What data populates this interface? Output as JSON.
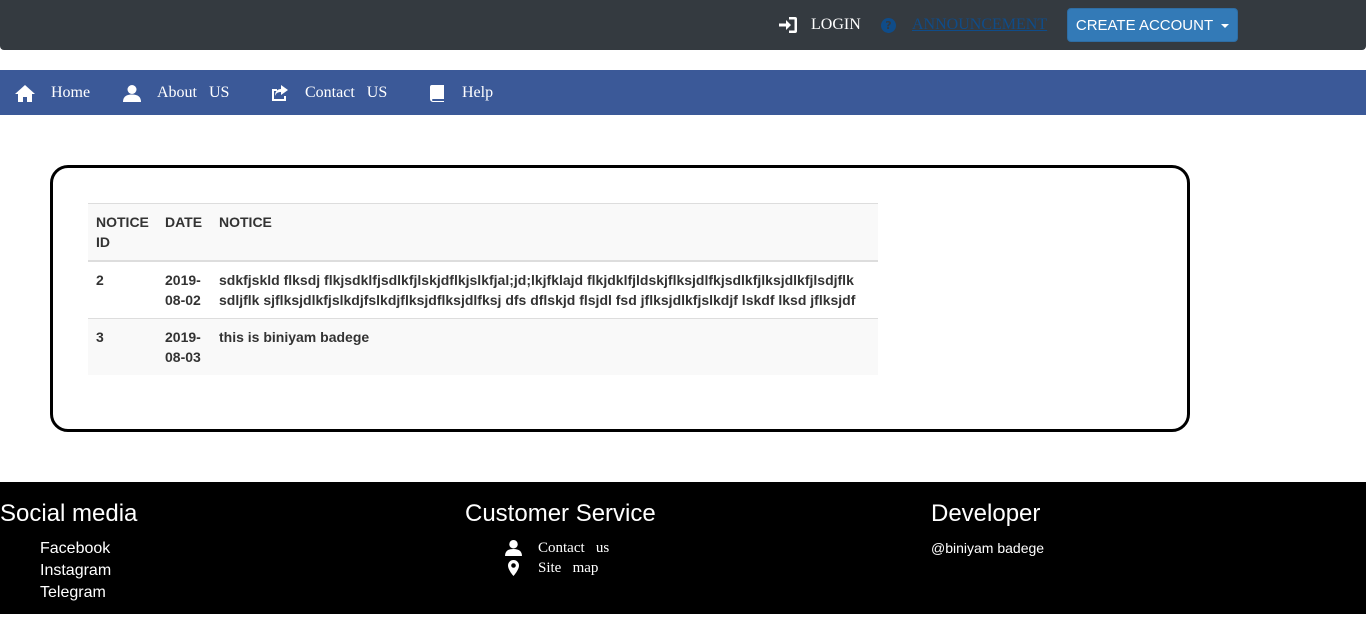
{
  "topbar": {
    "login_label": "LOGIN",
    "announcement_label": "ANNOUNCEMENT",
    "create_account_label": "CREATE ACCOUNT"
  },
  "nav": {
    "items": [
      {
        "label": "Home",
        "icon": "home-icon"
      },
      {
        "label": "About   US",
        "icon": "user-icon"
      },
      {
        "label": "Contact   US",
        "icon": "share-icon"
      },
      {
        "label": "Help",
        "icon": "book-icon"
      }
    ]
  },
  "notices": {
    "columns": [
      "NOTICE ID",
      "DATE",
      "NOTICE"
    ],
    "rows": [
      {
        "id": "2",
        "date": "2019-08-02",
        "notice": "sdkfjskld flksdj flkjsdklfjsdlkfjlskjdflkjslkfjal;jd;lkjfklajd flkjdklfjldskjflksjdlfkjsdlkfjlksjdlkfjlsdjflk sdljflk sjflksjdlkfjslkdjfslkdjflksjdflksjdlfksj dfs dflskjd flsjdl fsd jflksjdlkfjslkdjf lskdf lksd jflksjdf"
      },
      {
        "id": "3",
        "date": "2019-08-03",
        "notice": "this is biniyam badege"
      }
    ]
  },
  "footer": {
    "social": {
      "title": "Social media",
      "links": [
        "Facebook",
        "Instagram",
        "Telegram"
      ]
    },
    "service": {
      "title": "Customer Service",
      "links": [
        {
          "label": "Contact   us",
          "icon": "user-icon"
        },
        {
          "label": "Site   map",
          "icon": "map-marker-icon"
        }
      ]
    },
    "developer": {
      "title": "Developer",
      "text": "@biniyam badege"
    }
  },
  "colors": {
    "topbar_bg": "#343a40",
    "navbar_bg": "#3b5998",
    "button_bg": "#337ab7",
    "announcement_link": "#0f4c89",
    "footer_bg": "#000000"
  }
}
